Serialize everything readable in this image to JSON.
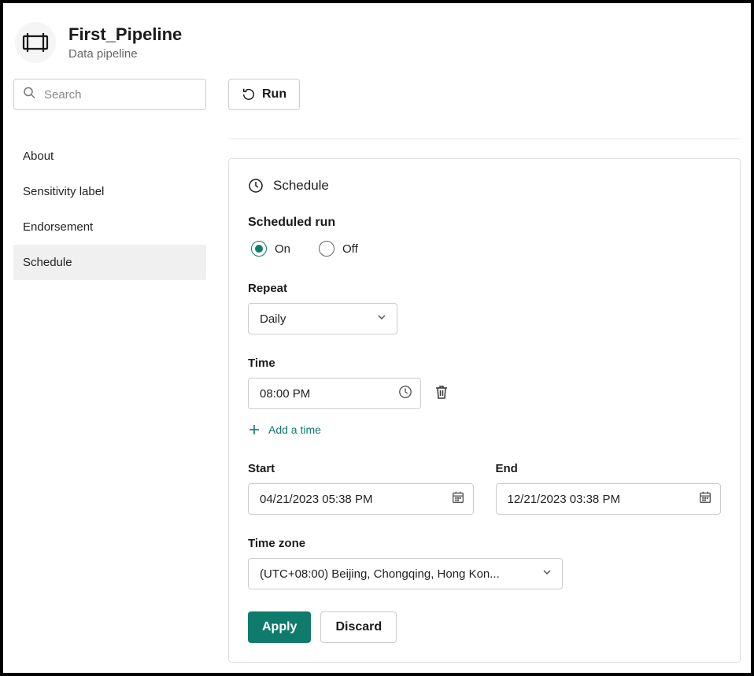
{
  "header": {
    "title": "First_Pipeline",
    "subtitle": "Data pipeline"
  },
  "sidebar": {
    "search_placeholder": "Search",
    "items": [
      {
        "label": "About",
        "active": false
      },
      {
        "label": "Sensitivity label",
        "active": false
      },
      {
        "label": "Endorsement",
        "active": false
      },
      {
        "label": "Schedule",
        "active": true
      }
    ]
  },
  "toolbar": {
    "run_label": "Run"
  },
  "schedule": {
    "panel_title": "Schedule",
    "scheduled_run": {
      "label": "Scheduled run",
      "on_label": "On",
      "off_label": "Off",
      "value": "on"
    },
    "repeat": {
      "label": "Repeat",
      "value": "Daily"
    },
    "time": {
      "label": "Time",
      "value": "08:00 PM",
      "add_label": "Add a time"
    },
    "start": {
      "label": "Start",
      "value": "04/21/2023 05:38 PM"
    },
    "end": {
      "label": "End",
      "value": "12/21/2023 03:38 PM"
    },
    "timezone": {
      "label": "Time zone",
      "value": "(UTC+08:00) Beijing, Chongqing, Hong Kon..."
    },
    "buttons": {
      "apply": "Apply",
      "discard": "Discard"
    }
  }
}
